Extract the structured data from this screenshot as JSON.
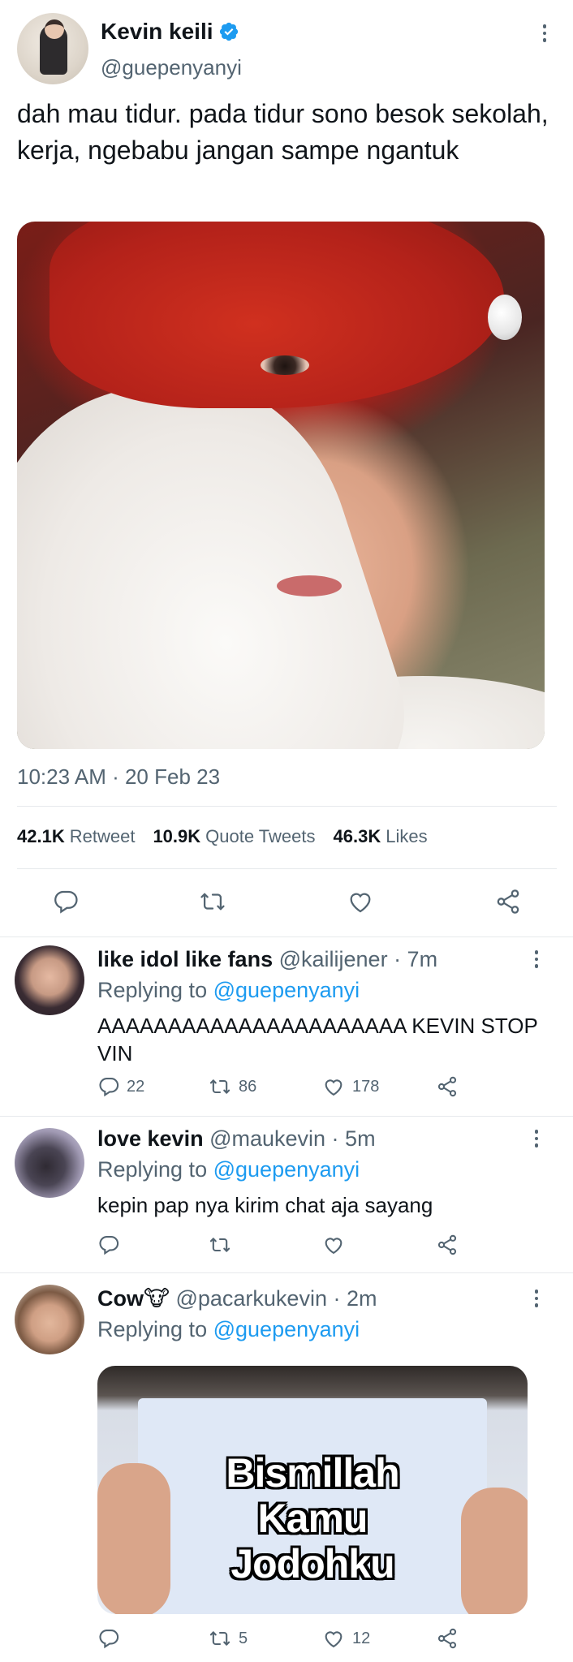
{
  "main_tweet": {
    "display_name": "Kevin keili",
    "handle": "@guepenyanyi",
    "text": "dah mau tidur. pada tidur sono besok sekolah, kerja, ngebabu jangan sampe ngantuk",
    "timestamp": "10:23 AM · 20 Feb 23",
    "stats": [
      {
        "value": "42.1K",
        "label": "Retweet"
      },
      {
        "value": "10.9K",
        "label": "Quote Tweets"
      },
      {
        "value": "46.3K",
        "label": "Likes"
      }
    ],
    "icons": {
      "verified": "verified-badge-icon",
      "more": "more-options-icon",
      "reply": "reply-icon",
      "retweet": "retweet-icon",
      "like": "heart-icon",
      "share": "share-icon"
    },
    "colors": {
      "accent": "#1d9bf0",
      "secondary_text": "#536471",
      "primary_text": "#0f1419"
    }
  },
  "replies": [
    {
      "display_name": "like idol like fans",
      "handle": "@kailijener · 7m",
      "replying_prefix": "Replying to",
      "replying_to": "@guepenyanyi",
      "text": "AAAAAAAAAAAAAAAAAAAAAA KEVIN STOP VIN",
      "reply_count": "22",
      "retweet_count": "86",
      "like_count": "178"
    },
    {
      "display_name": "love kevin",
      "handle": "@maukevin · 5m",
      "replying_prefix": "Replying to",
      "replying_to": "@guepenyanyi",
      "text": "kepin pap nya kirim chat aja sayang",
      "reply_count": "",
      "retweet_count": "",
      "like_count": ""
    },
    {
      "display_name": "Cow🐮",
      "handle": "@pacarkukevin · 2m",
      "replying_prefix": "Replying to",
      "replying_to": "@guepenyanyi",
      "media_text": [
        "Bismillah",
        "Kamu",
        "Jodohku"
      ],
      "reply_count": "",
      "retweet_count": "5",
      "like_count": "12"
    }
  ]
}
